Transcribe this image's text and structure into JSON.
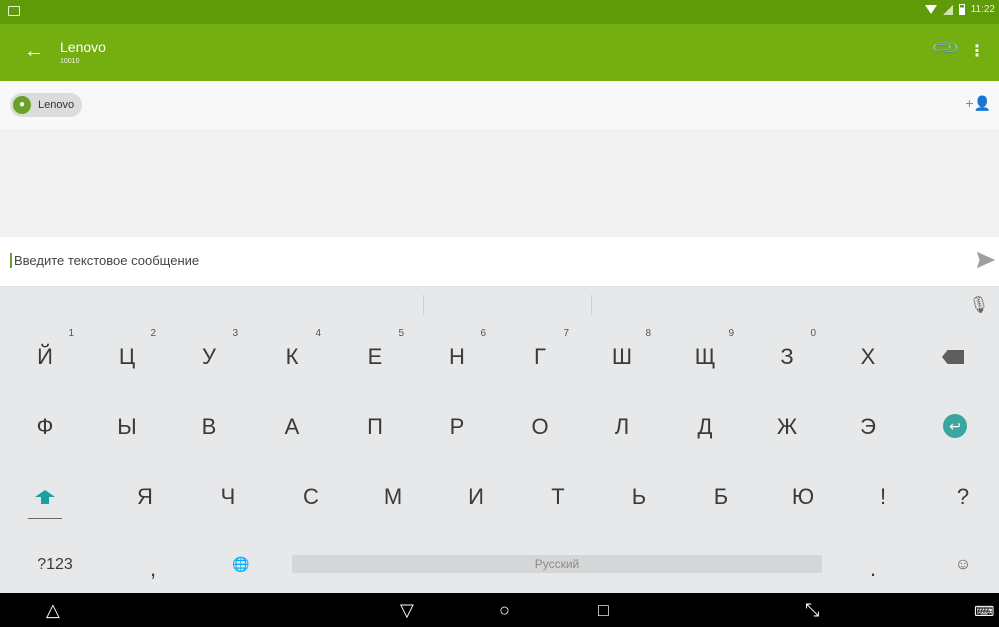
{
  "status": {
    "time": "11:22"
  },
  "header": {
    "title": "Lenovo",
    "subtitle": "10010"
  },
  "recipient": {
    "name": "Lenovo"
  },
  "compose": {
    "placeholder": "Введите текстовое сообщение"
  },
  "keyboard": {
    "rows": [
      [
        "Й",
        "Ц",
        "У",
        "К",
        "Е",
        "Н",
        "Г",
        "Ш",
        "Щ",
        "З",
        "Х"
      ],
      [
        "Ф",
        "Ы",
        "В",
        "А",
        "П",
        "Р",
        "О",
        "Л",
        "Д",
        "Ж",
        "Э"
      ],
      [
        "Я",
        "Ч",
        "С",
        "М",
        "И",
        "Т",
        "Ь",
        "Б",
        "Ю",
        "!",
        "?"
      ]
    ],
    "numbers": [
      "1",
      "2",
      "3",
      "4",
      "5",
      "6",
      "7",
      "8",
      "9",
      "0"
    ],
    "mode_key": "?123",
    "comma": ",",
    "period": ".",
    "space_label": "Русский"
  },
  "colors": {
    "appbar": "#74ae10",
    "statusbar": "#5f9a08",
    "accent": "#3aa6a0"
  }
}
